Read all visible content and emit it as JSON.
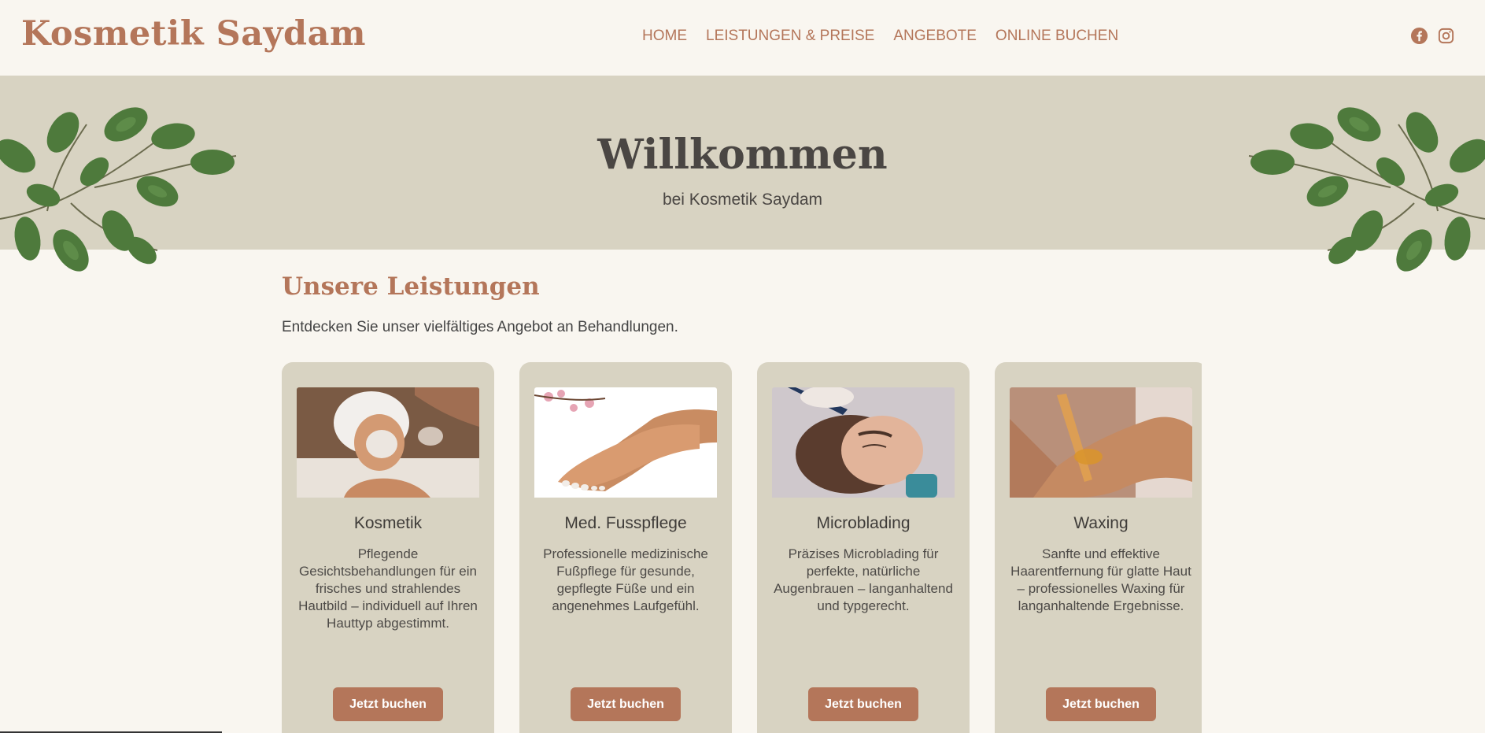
{
  "header": {
    "logo": "Kosmetik Saydam",
    "nav": [
      "HOME",
      "LEISTUNGEN & PREISE",
      "ANGEBOTE",
      "ONLINE BUCHEN"
    ],
    "social_icons": [
      "facebook-icon",
      "instagram-icon"
    ]
  },
  "hero": {
    "title": "Willkommen",
    "subtitle": "bei Kosmetik Saydam"
  },
  "services": {
    "title": "Unsere Leistungen",
    "description": "Entdecken Sie unser vielfältiges Angebot an Behandlungen.",
    "cards": [
      {
        "title": "Kosmetik",
        "text": "Pflegende Gesichtsbehandlungen für ein frisches und strahlendes Hautbild – individuell auf Ihren Hauttyp abgestimmt.",
        "button": "Jetzt buchen"
      },
      {
        "title": "Med. Fusspflege",
        "text": "Professionelle medizinische Fußpflege für gesunde, gepflegte Füße und ein angenehmes Laufgefühl.",
        "button": "Jetzt buchen"
      },
      {
        "title": "Microblading",
        "text": "Präzises Microblading für perfekte, natürliche Augenbrauen – langanhaltend und typgerecht.",
        "button": "Jetzt buchen"
      },
      {
        "title": "Waxing",
        "text": "Sanfte und effektive Haarentfernung für glatte Haut – professionelles Waxing für langanhaltende Ergebnisse.",
        "button": "Jetzt buchen"
      }
    ]
  },
  "colors": {
    "accent": "#b4765a",
    "background": "#f9f6f0",
    "hero": "#d8d3c2",
    "text": "#444444"
  }
}
